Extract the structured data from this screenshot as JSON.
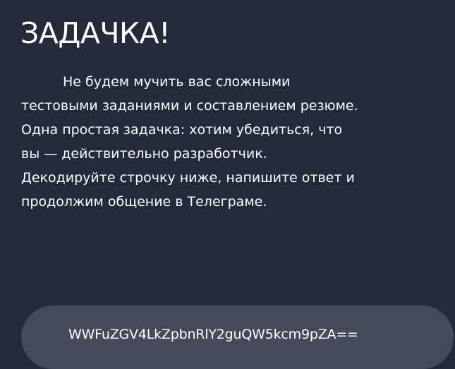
{
  "title": "ЗАДАЧКА!",
  "intro_text": "Не будем мучить вас сложными тестовыми заданиями и составлением резюме. Одна простая задачка: хотим убедиться, что вы — действительно разработчик. Декодируйте строчку ниже, напишите ответ и продолжим общение в Телеграме.",
  "encoded_string": "WWFuZGV4LkZpbnRlY2guQW5kcm9pZA==",
  "colors": {
    "background": "#232a3a",
    "text": "#ffffff",
    "code_box": "#454a58"
  }
}
